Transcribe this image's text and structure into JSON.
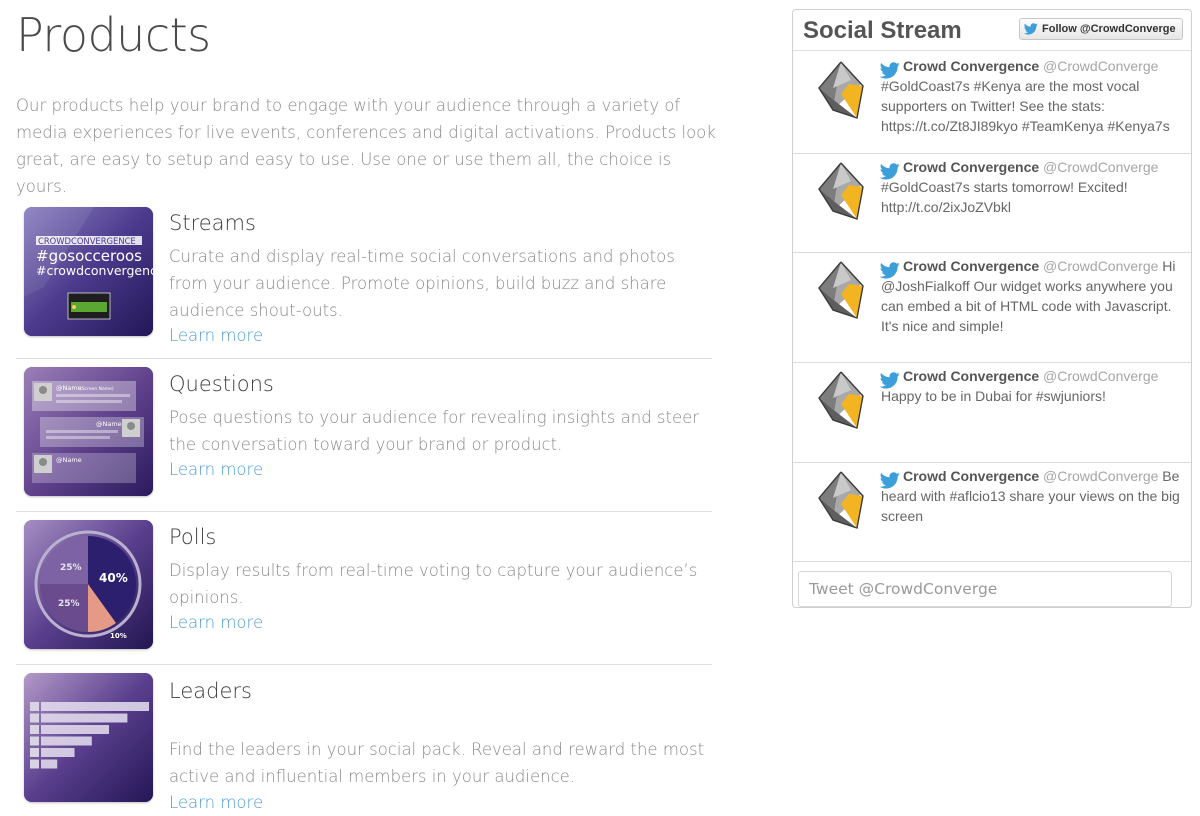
{
  "page": {
    "title": "Products",
    "intro": "Our products help your brand to engage with your audience through a variety of media experiences for live events, conferences and digital activations. Products look great, are easy to setup and easy to use. Use one or use them all, the choice is yours."
  },
  "products": [
    {
      "title": "Streams",
      "description": "Curate and display real-time social conversations and photos from your audience. Promote opinions, build buzz and share audience shout-outs.",
      "link": "Learn more",
      "thumb": {
        "brand": "CROWDCONVERGENCE",
        "tag1": "#gosocceroos",
        "tag2": "#crowdconvergence"
      }
    },
    {
      "title": "Questions",
      "description": "Pose questions to your audience for revealing insights and steer the conversation toward your brand or product.",
      "link": "Learn more",
      "thumb": {
        "name1": "@Name",
        "name1_sub": "(Screen Name)",
        "name2": "@Name",
        "name3": "@Name"
      }
    },
    {
      "title": "Polls",
      "description": "Display results from real-time voting to capture your audience’s opinions.",
      "link": "Learn more",
      "thumb": {
        "slice_a": "25%",
        "slice_b": "25%",
        "slice_c": "40%",
        "slice_d": "10%"
      }
    },
    {
      "title": "Leaders",
      "description": "Find the leaders in your social pack. Reveal and reward the most active and influential members in your audience.",
      "link": "Learn more",
      "thumb": {
        "bars": [
          1.0,
          0.8,
          0.63,
          0.47,
          0.31,
          0.15
        ]
      }
    }
  ],
  "social_stream": {
    "title": "Social Stream",
    "follow_label": "Follow @CrowdConverge",
    "tweet_placeholder": "Tweet @CrowdConverge",
    "tweets": [
      {
        "name": "Crowd Convergence",
        "handle": "@CrowdConverge",
        "text": "#GoldCoast7s #Kenya are the most vocal supporters on Twitter! See the stats: https://t.co/Zt8JI89kyo #TeamKenya #Kenya7s"
      },
      {
        "name": "Crowd Convergence",
        "handle": "@CrowdConverge",
        "text": "#GoldCoast7s starts tomorrow! Excited! http://t.co/2ixJoZVbkl"
      },
      {
        "name": "Crowd Convergence",
        "handle": "@CrowdConverge",
        "text": "Hi @JoshFialkoff Our widget works anywhere you can embed a bit of HTML code with Javascript. It's nice and simple!"
      },
      {
        "name": "Crowd Convergence",
        "handle": "@CrowdConverge",
        "text": "Happy to be in Dubai for #swjuniors!"
      },
      {
        "name": "Crowd Convergence",
        "handle": "@CrowdConverge",
        "text": "Be heard with #aflcio13 share your views on the big screen"
      }
    ]
  },
  "colors": {
    "link": "#4e9bd6",
    "twitter": "#3d9fd9",
    "logo_yellow": "#f2b521",
    "logo_grey": "#7d7d7d"
  }
}
